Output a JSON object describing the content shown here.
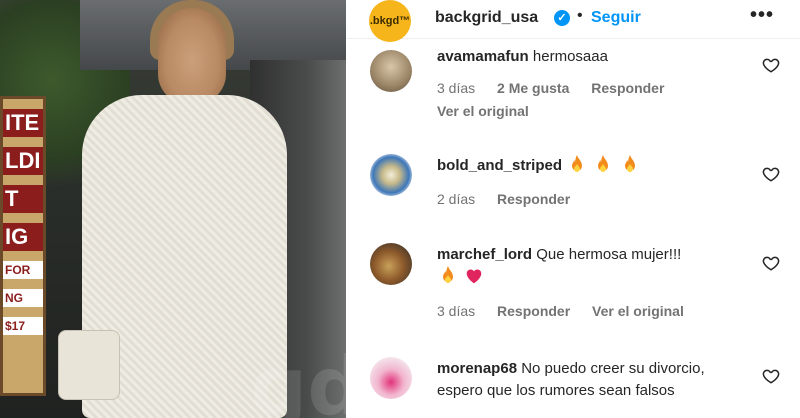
{
  "post": {
    "account": "backgrid_usa",
    "logo_text": ".bkgd™",
    "separator": "•",
    "follow_label": "Seguir",
    "more_label": "•••",
    "verified_icon": "verified-check-icon",
    "photo_watermark": "gd"
  },
  "photo_sign": [
    "ITE",
    "LDI",
    "T",
    "IG",
    "FOR",
    "NG",
    "$17"
  ],
  "comments": [
    {
      "user": "avamamafun",
      "text": "hermosaaa",
      "time": "3 días",
      "likes": "2 Me gusta",
      "reply": "Responder",
      "original": "Ver el original",
      "emojis": []
    },
    {
      "user": "bold_and_striped",
      "text": "",
      "time": "2 días",
      "reply": "Responder",
      "emojis": [
        "fire-emoji",
        "fire-emoji",
        "fire-emoji"
      ]
    },
    {
      "user": "marchef_lord",
      "text": "Que hermosa mujer!!!",
      "time": "3 días",
      "reply": "Responder",
      "original": "Ver el original",
      "emojis": [
        "fire-emoji",
        "heart-emoji"
      ]
    },
    {
      "user": "morenap68",
      "text": "No puedo creer su divorcio, espero que los rumores sean falsos"
    }
  ],
  "colors": {
    "link_blue": "#0095f6",
    "muted_text": "#737373",
    "logo_yellow": "#f6b51a"
  }
}
